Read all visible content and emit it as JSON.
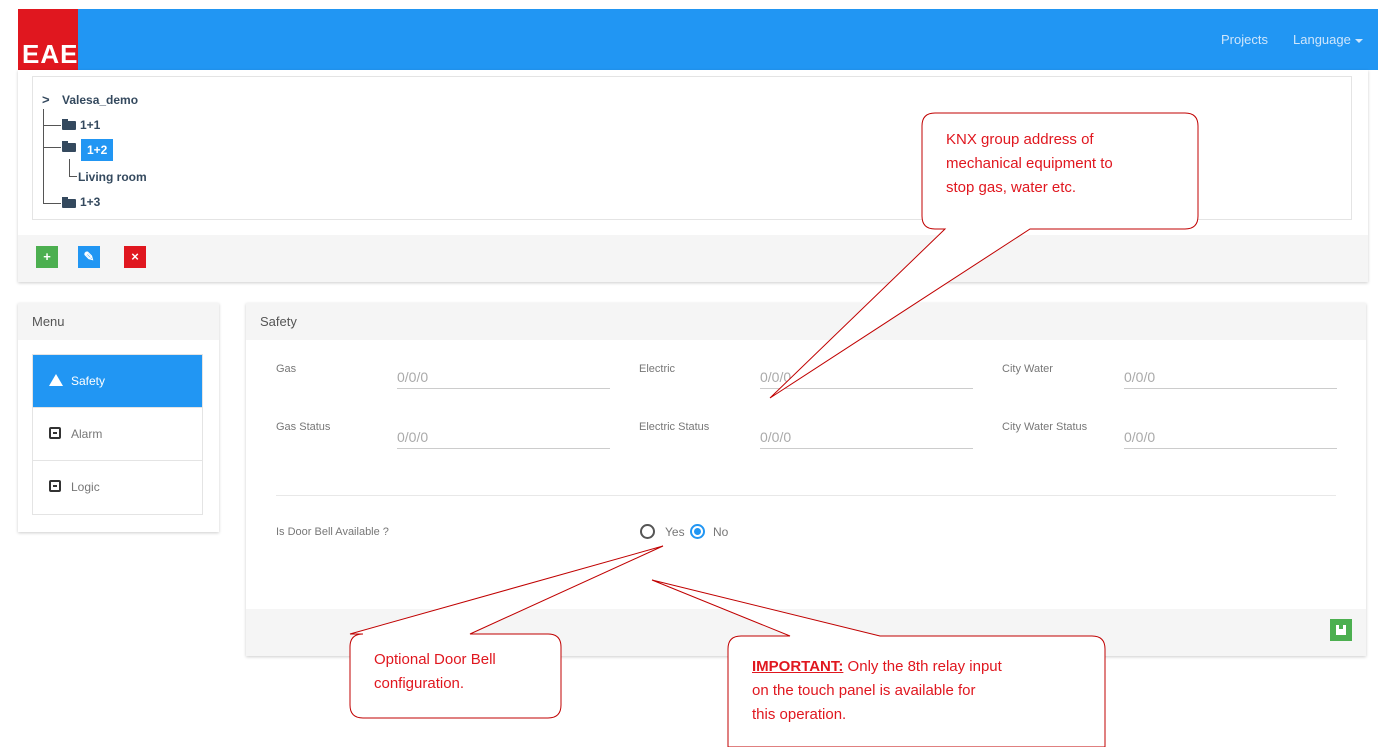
{
  "header": {
    "logo_text": "EAE",
    "nav": {
      "projects": "Projects",
      "language": "Language"
    }
  },
  "tree": {
    "root": "Valesa_demo",
    "nodes": [
      "1+1",
      "1+2",
      "Living room",
      "1+3"
    ]
  },
  "toolbar": {
    "add_label": "+",
    "edit_label": "✎",
    "delete_label": "×"
  },
  "menu": {
    "title": "Menu",
    "items": [
      {
        "label": "Safety",
        "icon": "warning-icon",
        "active": true
      },
      {
        "label": "Alarm",
        "icon": "alarm-icon",
        "active": false
      },
      {
        "label": "Logic",
        "icon": "logic-icon",
        "active": false
      }
    ]
  },
  "safety": {
    "title": "Safety",
    "fields": [
      {
        "label": "Gas",
        "value": "0/0/0"
      },
      {
        "label": "Electric",
        "value": "0/0/0"
      },
      {
        "label": "City Water",
        "value": "0/0/0"
      },
      {
        "label": "Gas Status",
        "value": "0/0/0"
      },
      {
        "label": "Electric Status",
        "value": "0/0/0"
      },
      {
        "label": "City Water Status",
        "value": "0/0/0"
      }
    ],
    "door_bell_question": "Is Door Bell Available ?",
    "options": [
      "Yes",
      "No"
    ],
    "selected": "No"
  },
  "annotations": {
    "knx": "KNX group address of\nmechanical equipment to\nstop gas, water etc.",
    "door_bell": "Optional Door Bell\nconfiguration.",
    "important_prefix": "IMPORTANT:",
    "important_text": " Only the 8th relay input\non the touch panel is available for\nthis operation."
  },
  "colors": {
    "primary": "#2196f3",
    "brand_red": "#e0171f",
    "success": "#4caf50",
    "annotation": "#e0171f"
  }
}
